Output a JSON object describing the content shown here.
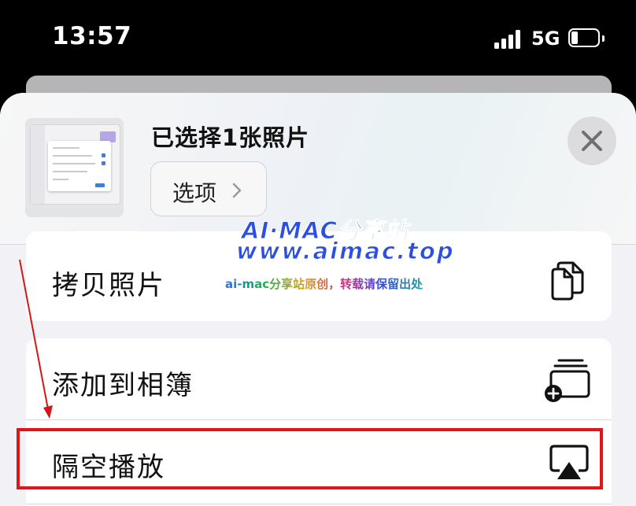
{
  "status_bar": {
    "time": "13:57",
    "network": "5G",
    "signal_bars": 4,
    "battery_level": 0.2
  },
  "share_sheet": {
    "title": "已选择1张照片",
    "options_label": "选项",
    "close_icon": "close-icon"
  },
  "actions": {
    "copy_photo": {
      "label": "拷贝照片",
      "icon": "copy-icon"
    },
    "add_to_album": {
      "label": "添加到相簿",
      "icon": "add-to-album-icon"
    },
    "airplay": {
      "label": "隔空播放",
      "icon": "airplay-icon"
    }
  },
  "watermark": {
    "line1": "AI·MAC分享站",
    "line2": "www.aimac.top",
    "line3": "ai-mac分享站原创，转载请保留出处"
  },
  "colors": {
    "highlight": "#e01616",
    "arrow": "#d01818",
    "watermark_blue": "#2c4fe0"
  }
}
